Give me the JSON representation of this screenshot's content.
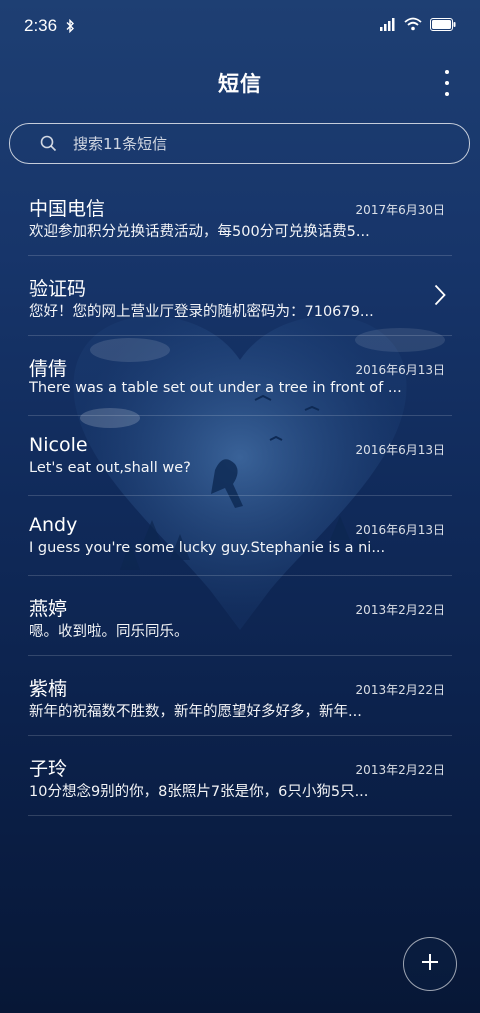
{
  "status_bar": {
    "time": "2:36"
  },
  "header": {
    "title": "短信"
  },
  "search": {
    "placeholder": "搜索11条短信"
  },
  "messages": [
    {
      "sender": "中国电信",
      "date": "2017年6月30日",
      "preview": "欢迎参加积分兑换话费活动，每500分可兑换话费5..."
    },
    {
      "sender": "验证码",
      "date": "",
      "preview": "您好！您的网上营业厅登录的随机密码为：710679..."
    },
    {
      "sender": "倩倩",
      "date": "2016年6月13日",
      "preview": "There was a table set out under a tree in front of ..."
    },
    {
      "sender": "Nicole",
      "date": "2016年6月13日",
      "preview": "Let's eat out,shall we?"
    },
    {
      "sender": "Andy",
      "date": "2016年6月13日",
      "preview": "I guess you're some lucky guy.Stephanie is a ni..."
    },
    {
      "sender": "燕婷",
      "date": "2013年2月22日",
      "preview": "嗯。收到啦。同乐同乐。"
    },
    {
      "sender": "紫楠",
      "date": "2013年2月22日",
      "preview": "新年的祝福数不胜数，新年的愿望好多好多，新年..."
    },
    {
      "sender": "子玲",
      "date": "2013年2月22日",
      "preview": "10分想念9别的你，8张照片7张是你，6只小狗5只..."
    }
  ],
  "icons": {
    "bluetooth": "bluetooth-icon",
    "signal": "signal-icon",
    "wifi": "wifi-icon",
    "battery": "battery-icon",
    "search": "search-icon",
    "more": "more-vertical-icon",
    "chevron": "chevron-right-icon",
    "compose": "plus-icon"
  },
  "colors": {
    "background_top": "#1e3f73",
    "background_bottom": "#071736",
    "text": "#ffffff"
  }
}
